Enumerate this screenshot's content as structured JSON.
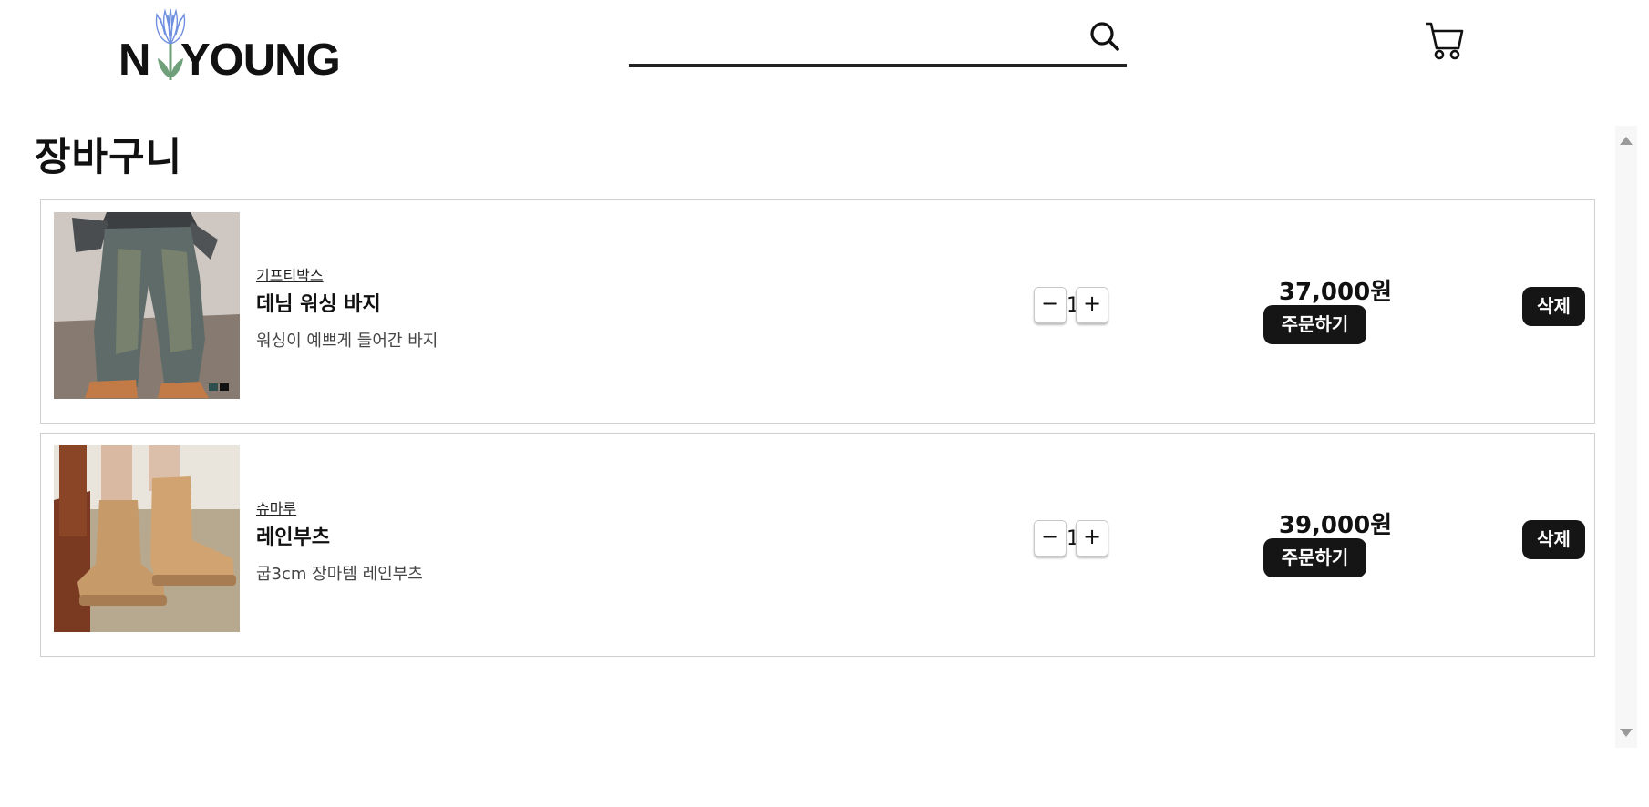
{
  "header": {
    "logo": {
      "text_left": "N",
      "text_right": "YOUNG"
    },
    "search": {
      "value": "",
      "placeholder": ""
    },
    "icons": {
      "search": "search-icon",
      "cart": "cart-icon",
      "logo_flower": "tulip-icon"
    }
  },
  "page": {
    "title": "장바구니"
  },
  "cart": {
    "items": [
      {
        "brand": "기프티박스",
        "name": "데님 워싱 바지",
        "description": "워싱이 예쁘게 들어간 바지",
        "quantity": "1",
        "price": "37,000원",
        "order_label": "주문하기",
        "delete_label": "삭제",
        "minus_label": "−",
        "plus_label": "+"
      },
      {
        "brand": "슈마루",
        "name": "레인부츠",
        "description": "굽3cm 장마템 레인부츠",
        "quantity": "1",
        "price": "39,000원",
        "order_label": "주문하기",
        "delete_label": "삭제",
        "minus_label": "−",
        "plus_label": "+"
      }
    ]
  },
  "colors": {
    "button_bg": "#151515",
    "button_text": "#ffffff",
    "flower_blue": "#6f8fe0",
    "leaf_green": "#6fa07a"
  }
}
